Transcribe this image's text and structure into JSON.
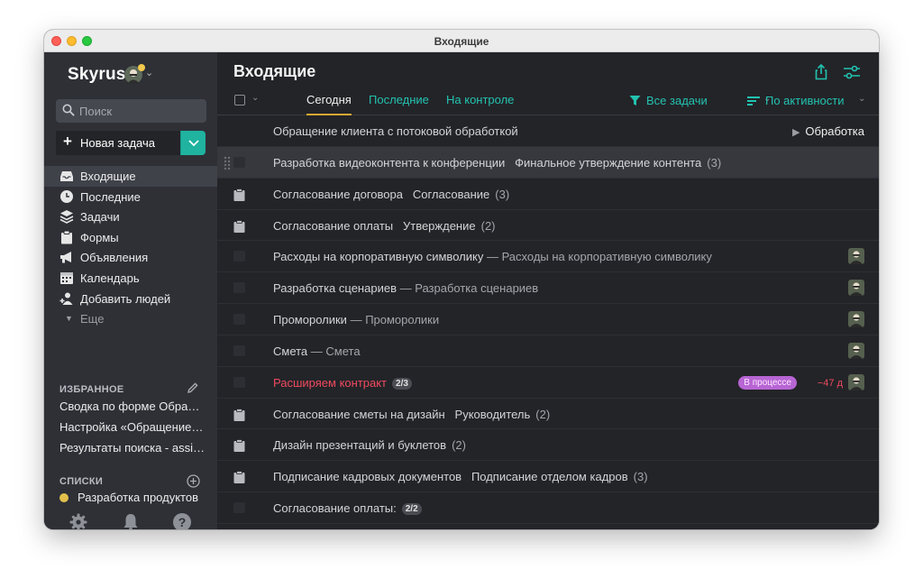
{
  "window": {
    "title": "Входящие"
  },
  "sidebar": {
    "brand": "Skyrus",
    "search": {
      "placeholder": "Поиск"
    },
    "new_task_label": "Новая задача",
    "nav": [
      {
        "label": "Входящие",
        "icon": "inbox-icon",
        "active": true
      },
      {
        "label": "Последние",
        "icon": "clock-icon"
      },
      {
        "label": "Задачи",
        "icon": "layers-icon"
      },
      {
        "label": "Формы",
        "icon": "clipboard-icon"
      },
      {
        "label": "Объявления",
        "icon": "megaphone-icon"
      },
      {
        "label": "Календарь",
        "icon": "calendar-icon"
      },
      {
        "label": "Добавить людей",
        "icon": "add-people-icon"
      }
    ],
    "more_label": "Еще",
    "favorites_header": "ИЗБРАННОЕ",
    "favorites": [
      "Сводка по форме Обращение клиента",
      "Настройка «Обращение клиента»",
      "Результаты поиска - assignee"
    ],
    "lists_header": "СПИСКИ",
    "lists": [
      {
        "label": "Разработка продуктов",
        "color": "#e2c14b"
      }
    ]
  },
  "main": {
    "title": "Входящие",
    "tabs": [
      {
        "label": "Сегодня",
        "active": true
      },
      {
        "label": "Последние"
      },
      {
        "label": "На контроле"
      }
    ],
    "filter_label": "Все задачи",
    "sort_label": "По активности",
    "tasks": [
      {
        "title": "Обращение клиента с потоковой обработкой",
        "sub": "",
        "count": "",
        "stage": "Обработка",
        "icon": "none"
      },
      {
        "title": "Разработка видеоконтента к конференции",
        "sub": "Финальное утверждение контента",
        "count": "(3)",
        "icon": "check",
        "hover": true
      },
      {
        "title": "Согласование договора",
        "sub": "Согласование",
        "count": "(3)",
        "icon": "clipboard"
      },
      {
        "title": "Согласование оплаты",
        "sub": "Утверждение",
        "count": "(2)",
        "icon": "clipboard"
      },
      {
        "title": "Расходы на корпоративную символику",
        "sub": "— Расходы на корпоративную символику",
        "count": "",
        "icon": "check",
        "avatar": true
      },
      {
        "title": "Разработка сценариев",
        "sub": "— Разработка сценариев",
        "count": "",
        "icon": "check",
        "avatar": true
      },
      {
        "title": "Проморолики",
        "sub": "— Проморолики",
        "count": "",
        "icon": "check",
        "avatar": true
      },
      {
        "title": "Смета",
        "sub": "— Смета",
        "count": "",
        "icon": "check",
        "avatar": true
      },
      {
        "title": "Расширяем контракт",
        "pill": "2/3",
        "status": "В процессе",
        "due": "−47 д",
        "icon": "check",
        "avatar": true,
        "red": true
      },
      {
        "title": "Согласование сметы на дизайн",
        "sub": "Руководитель",
        "count": "(2)",
        "icon": "clipboard"
      },
      {
        "title": "Дизайн презентаций и буклетов",
        "sub": "",
        "count": "(2)",
        "icon": "clipboard"
      },
      {
        "title": "Подписание кадровых документов",
        "sub": "Подписание отделом кадров",
        "count": "(3)",
        "icon": "clipboard"
      },
      {
        "title": "Согласование оплаты:",
        "pill": "2/2",
        "icon": "check"
      }
    ]
  },
  "colors": {
    "accent": "#1fb3a0",
    "link": "#22c3b0",
    "danger": "#ef4a5f",
    "badge": "#b865d4",
    "tab_underline": "#d7a832"
  }
}
